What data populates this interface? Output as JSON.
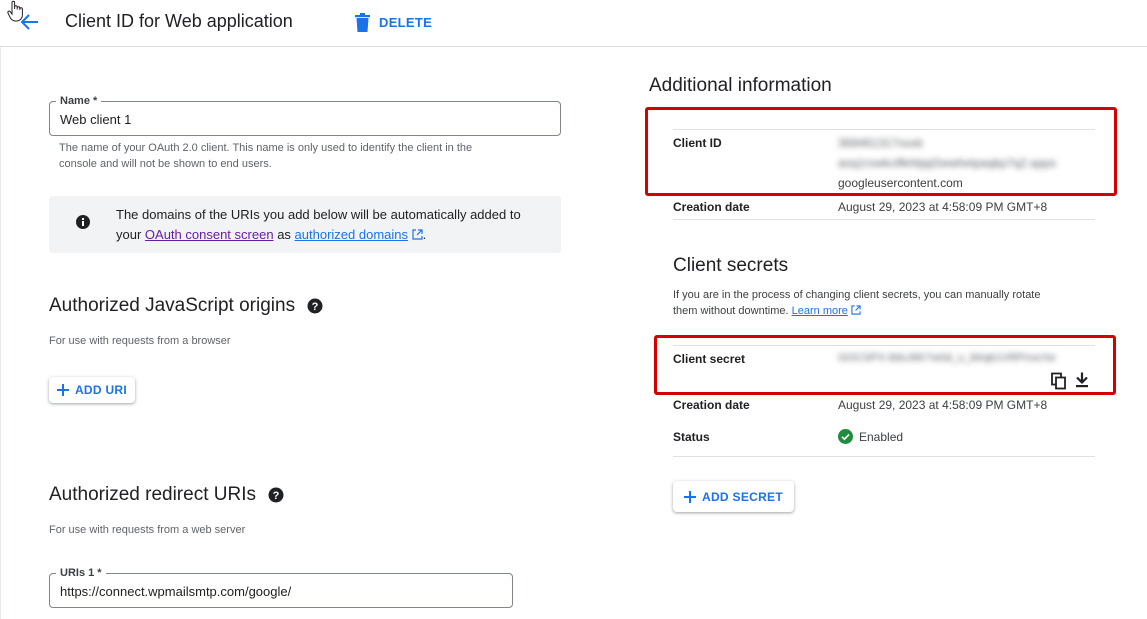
{
  "header": {
    "title": "Client ID for Web application",
    "delete_label": "DELETE"
  },
  "left": {
    "name_field": {
      "label": "Name *",
      "value": "Web client 1"
    },
    "name_help": [
      "The name of your OAuth 2.0 client. This name is only used to identify the client in the",
      "console and will not be shown to end users."
    ],
    "info": {
      "text_a": "The domains of the URIs you add below will be automatically added to",
      "text_b": "your",
      "link_consent": "OAuth consent screen",
      "text_c": "as",
      "link_domains": "authorized domains",
      "text_d": "."
    },
    "js_origins": {
      "title": "Authorized JavaScript origins",
      "subtitle": "For use with requests from a browser",
      "add_label": "ADD URI"
    },
    "redirect": {
      "title": "Authorized redirect URIs",
      "subtitle": "For use with requests from a web server",
      "uri_label": "URIs 1 *",
      "uri_value": "https://connect.wpmailsmtp.com/google/"
    }
  },
  "right": {
    "title": "Additional information",
    "client_id_label": "Client ID",
    "client_id_line1": "368461317xxxb",
    "client_id_line2": "aoq1rxwkctfkhbjql2wwhetpaqkp7q2.apps",
    "client_id_line3": "googleusercontent.com",
    "creation_label": "Creation date",
    "creation_value": "August 29, 2023 at 4:58:09 PM GMT+8",
    "secrets": {
      "title": "Client secrets",
      "desc_a": "If you are in the process of changing client secrets, you can manually rotate",
      "desc_b": "them without downtime.",
      "learn_more": "Learn more",
      "secret_label": "Client secret",
      "secret_value": "GOCSPX-8dvJ6K7w0d_u_8Aqk1VRPmxrXe",
      "creation_label": "Creation date",
      "creation_value": "August 29, 2023 at 4:58:09 PM GMT+8",
      "status_label": "Status",
      "status_value": "Enabled",
      "add_label": "ADD SECRET"
    }
  },
  "colors": {
    "accent": "#1a73e8",
    "highlight": "#d50000",
    "enabled": "#1e8e3e"
  }
}
